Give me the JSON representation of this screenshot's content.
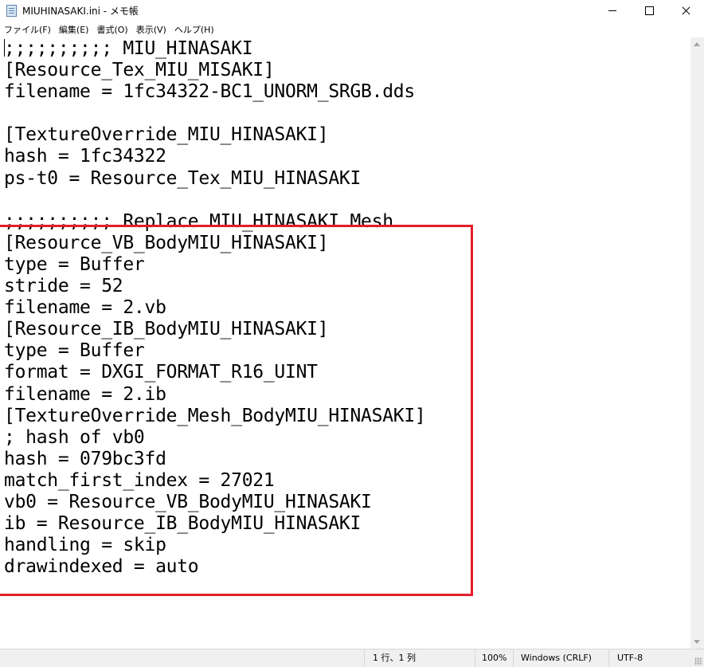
{
  "window": {
    "title": "MIUHINASAKI.ini - メモ帳"
  },
  "menu": [
    {
      "label": "ファイル(F)"
    },
    {
      "label": "編集(E)"
    },
    {
      "label": "書式(O)"
    },
    {
      "label": "表示(V)"
    },
    {
      "label": "ヘルプ(H)"
    }
  ],
  "editor": {
    "lines": [
      ";;;;;;;;;; MIU_HINASAKI",
      "[Resource_Tex_MIU_MISAKI]",
      "filename = 1fc34322-BC1_UNORM_SRGB.dds",
      "",
      "[TextureOverride_MIU_HINASAKI]",
      "hash = 1fc34322",
      "ps-t0 = Resource_Tex_MIU_HINASAKI",
      "",
      ";;;;;;;;;; Replace MIU_HINASAKI Mesh",
      "[Resource_VB_BodyMIU_HINASAKI]",
      "type = Buffer",
      "stride = 52",
      "filename = 2.vb",
      "[Resource_IB_BodyMIU_HINASAKI]",
      "type = Buffer",
      "format = DXGI_FORMAT_R16_UINT",
      "filename = 2.ib",
      "[TextureOverride_Mesh_BodyMIU_HINASAKI]",
      "; hash of vb0",
      "hash = 079bc3fd",
      "match_first_index = 27021",
      "vb0 = Resource_VB_BodyMIU_HINASAKI",
      "ib = Resource_IB_BodyMIU_HINASAKI",
      "handling = skip",
      "drawindexed = auto"
    ]
  },
  "status": {
    "position": "1 行、1 列",
    "zoom": "100%",
    "line_ending": "Windows (CRLF)",
    "encoding": "UTF-8"
  },
  "colors": {
    "highlight": "#e31e2b",
    "statusbar_bg": "#f0f0f0"
  },
  "icons": {
    "app": "notepad-icon",
    "minimize": "minimize-icon",
    "maximize": "maximize-icon",
    "close": "close-icon"
  }
}
